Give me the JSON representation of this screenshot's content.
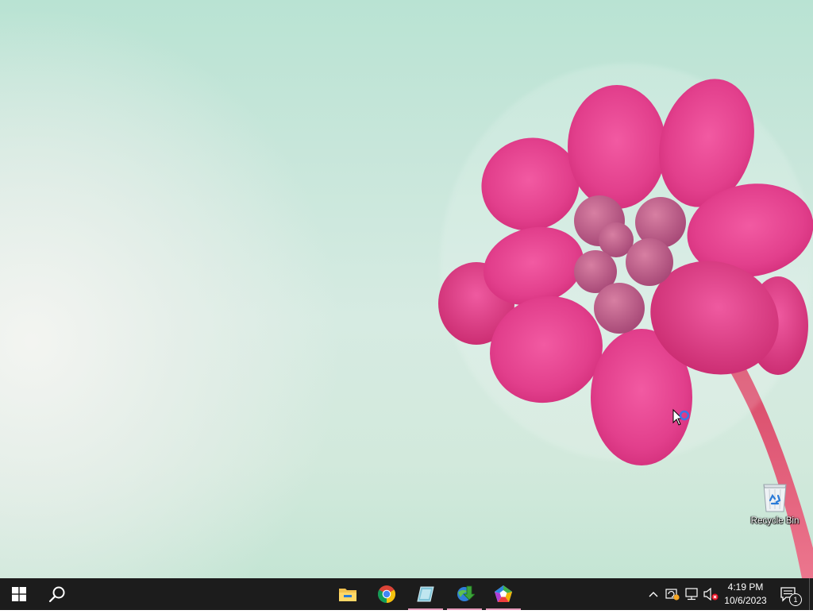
{
  "wallpaper": {
    "name": "pink-flower-wallpaper",
    "colors": {
      "background": "#c7e6da",
      "petal": "#e8468f",
      "petal_dark": "#c92a6f",
      "stem": "#e23c64"
    }
  },
  "desktop": {
    "icons": [
      {
        "label": "Recycle Bin",
        "icon": "recycle-bin-icon"
      }
    ]
  },
  "taskbar": {
    "background": "#1c1c1c",
    "start_icon": "windows-logo-icon",
    "search_icon": "search-icon",
    "pinned_apps": [
      {
        "icon": "file-explorer-icon",
        "running": false
      },
      {
        "icon": "chrome-icon",
        "running": false
      },
      {
        "icon": "app-window-icon",
        "running": true
      },
      {
        "icon": "internet-download-manager-icon",
        "running": true
      },
      {
        "icon": "colorful-pentagon-app-icon",
        "running": true
      }
    ],
    "tray": {
      "icons": [
        "chevron-up-icon",
        "update-icon",
        "network-icon",
        "volume-muted-icon"
      ],
      "time": "4:19 PM",
      "date": "10/6/2023",
      "notification_count": "1"
    }
  }
}
